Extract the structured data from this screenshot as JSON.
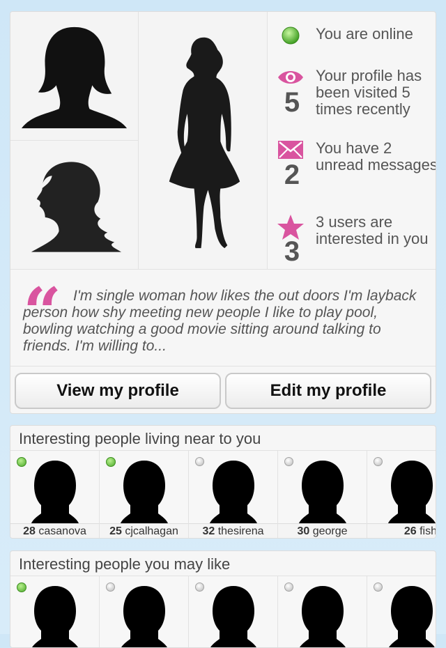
{
  "profile": {
    "stats": {
      "online": "You are online",
      "visits": {
        "number": "5",
        "text": "Your profile has been visited 5 times recently"
      },
      "messages": {
        "number": "2",
        "text": "You have 2 unread messages"
      },
      "interested": {
        "number": "3",
        "text": "3 users are interested in you"
      }
    },
    "quote": "I'm single woman how likes the out doors I'm layback person how shy meeting new people I like to play pool, bowling watching a good movie sitting around talking to friends. I'm willing to...",
    "buttons": {
      "view": "View my profile",
      "edit": "Edit my profile"
    }
  },
  "near": {
    "title": "Interesting people living near to you",
    "people": [
      {
        "age": "28",
        "name": "casanova",
        "online": true
      },
      {
        "age": "25",
        "name": "cjcalhagan",
        "online": true
      },
      {
        "age": "32",
        "name": "thesirena",
        "online": false
      },
      {
        "age": "30",
        "name": "george",
        "online": false
      },
      {
        "age": "26",
        "name": "fish",
        "online": false
      }
    ]
  },
  "like": {
    "title": "Interesting people you may like",
    "people": [
      {
        "online": true
      },
      {
        "online": false
      },
      {
        "online": false
      },
      {
        "online": false
      },
      {
        "online": false
      }
    ]
  },
  "colors": {
    "accent": "#d9549f",
    "online": "#4aa829",
    "offline": "#b9b9b9"
  }
}
